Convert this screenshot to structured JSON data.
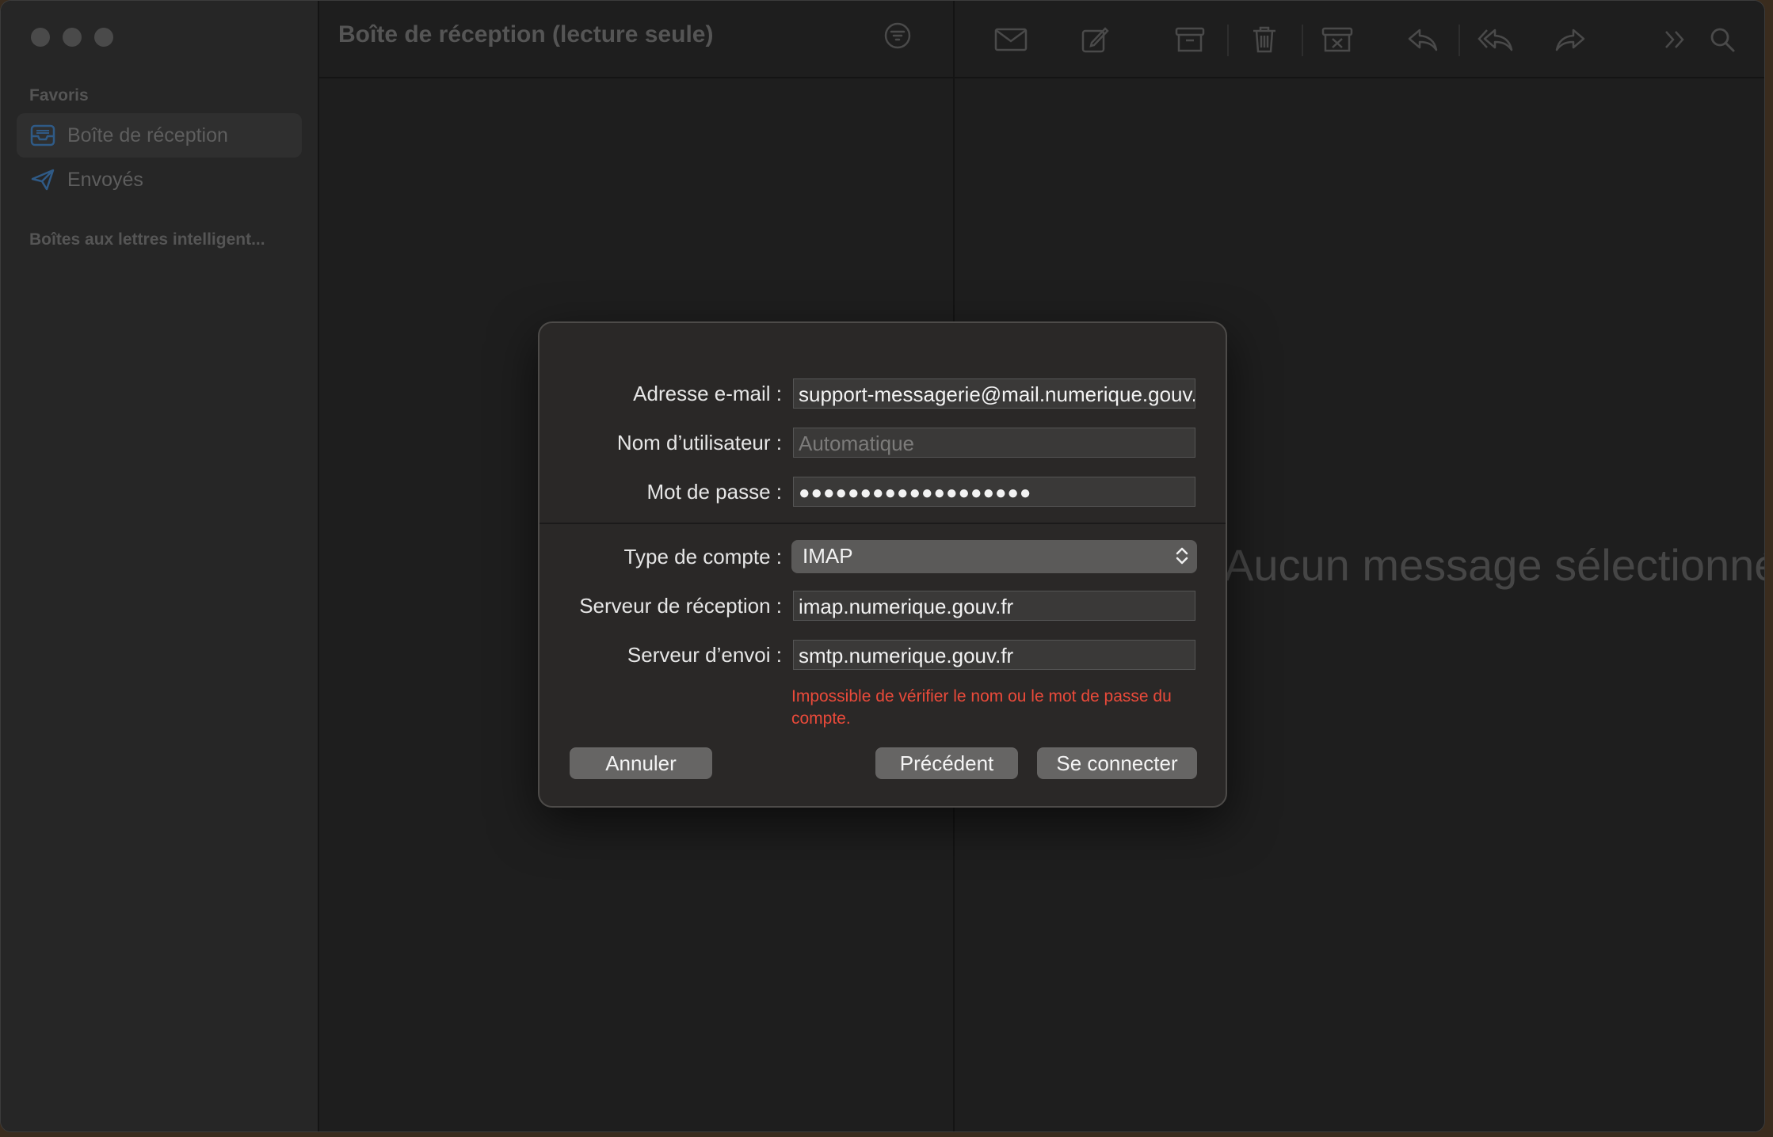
{
  "window": {
    "mailbox_title": "Boîte de réception (lecture seule)"
  },
  "sidebar": {
    "favorites_header": "Favoris",
    "items": [
      {
        "label": "Boîte de réception",
        "icon": "inbox-icon",
        "selected": true
      },
      {
        "label": "Envoyés",
        "icon": "paper-plane-icon",
        "selected": false
      }
    ],
    "smart_mailboxes_header": "Boîtes aux lettres intelligent..."
  },
  "viewer": {
    "empty_text": "Aucun message sélectionné",
    "toolbar_icons": [
      "envelope-icon",
      "compose-icon",
      "archive-icon",
      "trash-icon",
      "junk-icon",
      "reply-icon",
      "reply-all-icon",
      "forward-icon",
      "more-icon",
      "search-icon"
    ]
  },
  "dialog": {
    "email_label": "Adresse e-mail :",
    "email_value": "support-messagerie@mail.numerique.gouv.fr",
    "username_label": "Nom d’utilisateur :",
    "username_placeholder": "Automatique",
    "password_label": "Mot de passe :",
    "password_value": "●●●●●●●●●●●●●●●●●●●",
    "account_type_label": "Type de compte :",
    "account_type_value": "IMAP",
    "incoming_label": "Serveur de réception :",
    "incoming_value": "imap.numerique.gouv.fr",
    "outgoing_label": "Serveur d’envoi :",
    "outgoing_value": "smtp.numerique.gouv.fr",
    "error_text": "Impossible de vérifier le nom ou le mot de passe du compte.",
    "cancel_label": "Annuler",
    "previous_label": "Précédent",
    "connect_label": "Se connecter",
    "error_color": "#ea4a3a"
  }
}
